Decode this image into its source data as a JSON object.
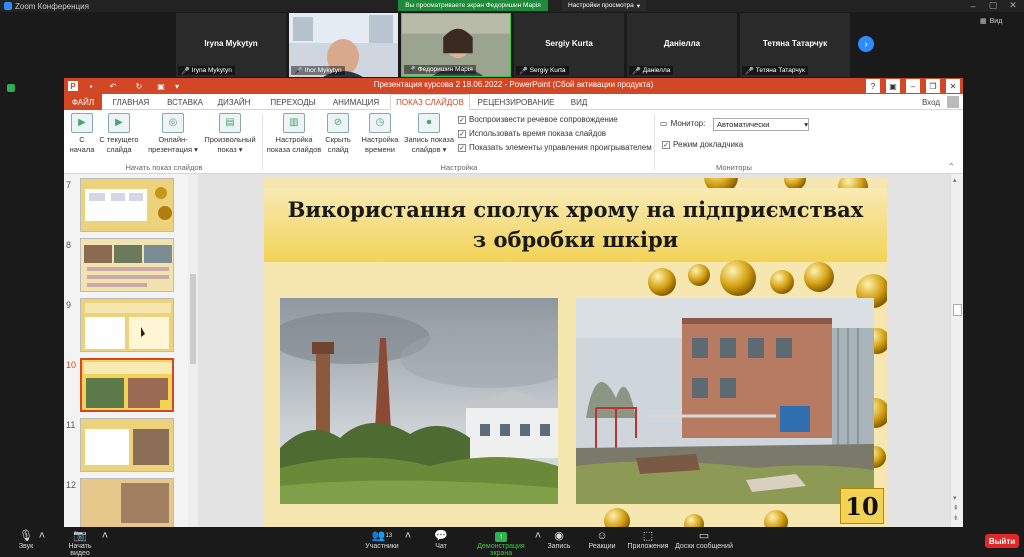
{
  "zoom": {
    "app_title": "Zoom Конференция",
    "share_banner": "Вы просматриваете экран Федоришин Марія",
    "view_options": "Настройки просмотра",
    "view_button": "Вид",
    "participants": [
      {
        "name": "Iryna Mykytyn",
        "label": "Iryna Mykytyn",
        "video": false
      },
      {
        "name": "",
        "label": "Ihor Mykytyn",
        "video": true
      },
      {
        "name": "",
        "label": "Федоришин Марія",
        "video": true
      },
      {
        "name": "Sergiy Kurta",
        "label": "Sergiy Kurta",
        "video": false
      },
      {
        "name": "Даніелла",
        "label": "Даніелла",
        "video": false
      },
      {
        "name": "Тетяна Татарчук",
        "label": "Тетяна Татарчук",
        "video": false
      }
    ],
    "toolbar": {
      "audio": "Звук",
      "video": "Начать видео",
      "participants_count": "13",
      "participants": "Участники",
      "chat": "Чат",
      "share": "Демонстрация экрана",
      "record": "Запись",
      "reactions": "Реакции",
      "apps": "Приложения",
      "whiteboards": "Доски сообщений",
      "leave": "Выйти"
    }
  },
  "powerpoint": {
    "window_title": "Презентация курсова 2 18.06.2022 -  PowerPoint (Сбой активации продукта)",
    "sign_in": "Вход",
    "tabs": [
      "ФАЙЛ",
      "ГЛАВНАЯ",
      "ВСТАВКА",
      "ДИЗАЙН",
      "ПЕРЕХОДЫ",
      "АНИМАЦИЯ",
      "ПОКАЗ СЛАЙДОВ",
      "РЕЦЕНЗИРОВАНИЕ",
      "ВИД"
    ],
    "active_tab": "ПОКАЗ СЛАЙДОВ",
    "ribbon": {
      "start": {
        "group": "Начать показ слайдов",
        "from_start_1": "С",
        "from_start_2": "начала",
        "from_current_1": "С текущего",
        "from_current_2": "слайда",
        "online_1": "Онлайн-",
        "online_2": "презентация ▾",
        "custom_1": "Произвольный",
        "custom_2": "показ ▾"
      },
      "setup": {
        "group": "Настройка",
        "setup_show_1": "Настройка",
        "setup_show_2": "показа слайдов",
        "hide_1": "Скрыть",
        "hide_2": "слайд",
        "rehearse_1": "Настройка",
        "rehearse_2": "времени",
        "record_1": "Запись показа",
        "record_2": "слайдов ▾",
        "play_narrations": "Воспроизвести речевое сопровождение",
        "use_timings": "Использовать время показа слайдов",
        "show_media_controls": "Показать элементы управления проигрывателем"
      },
      "monitors": {
        "group": "Мониторы",
        "monitor_label": "Монитор:",
        "monitor_value": "Автоматически",
        "presenter_view": "Режим докладчика"
      }
    },
    "thumbnails": [
      {
        "number": "7",
        "selected": false
      },
      {
        "number": "8",
        "selected": false
      },
      {
        "number": "9",
        "selected": false
      },
      {
        "number": "10",
        "selected": true
      },
      {
        "number": "11",
        "selected": false
      },
      {
        "number": "12",
        "selected": false
      }
    ],
    "slide": {
      "title_line1": "Використання сполук хрому на підприємствах",
      "title_line2": "з обробки шкіри",
      "number": "10"
    }
  }
}
